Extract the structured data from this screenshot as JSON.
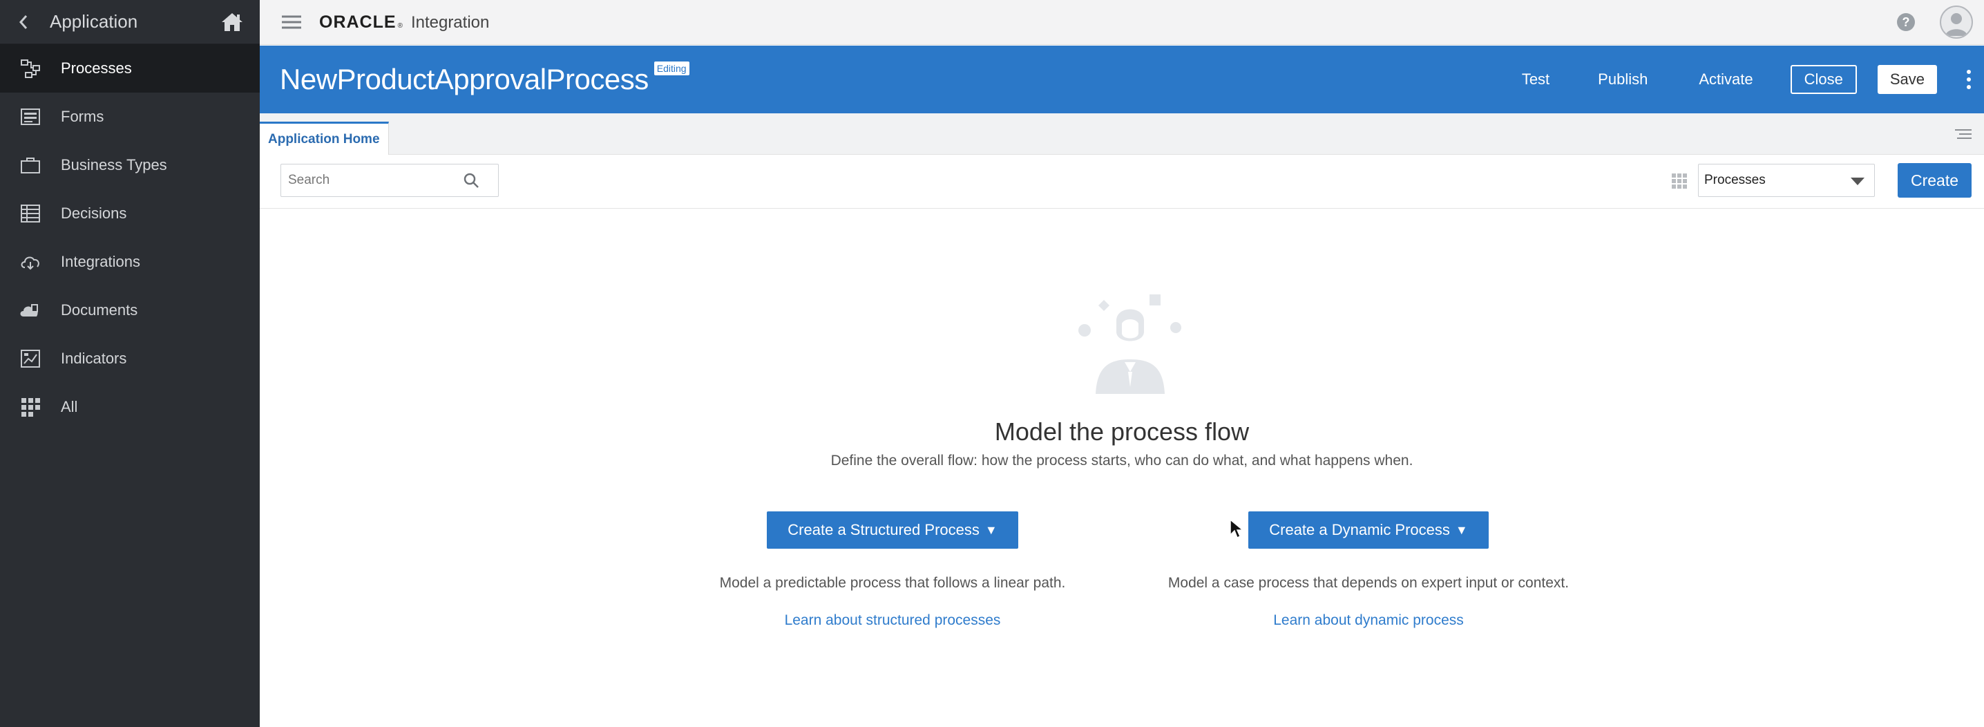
{
  "sidebar": {
    "title": "Application",
    "items": [
      {
        "label": "Processes",
        "icon": "process-icon",
        "active": true
      },
      {
        "label": "Forms",
        "icon": "forms-icon"
      },
      {
        "label": "Business Types",
        "icon": "briefcase-icon"
      },
      {
        "label": "Decisions",
        "icon": "table-icon"
      },
      {
        "label": "Integrations",
        "icon": "cloud-icon"
      },
      {
        "label": "Documents",
        "icon": "documents-icon"
      },
      {
        "label": "Indicators",
        "icon": "indicators-icon"
      },
      {
        "label": "All",
        "icon": "grid-icon"
      }
    ]
  },
  "topbar": {
    "brand": "ORACLE",
    "product": "Integration"
  },
  "appbar": {
    "title": "NewProductApprovalProcess",
    "badge": "Editing",
    "actions": {
      "test": "Test",
      "publish": "Publish",
      "activate": "Activate",
      "close": "Close",
      "save": "Save"
    }
  },
  "tabs": [
    {
      "label": "Application Home",
      "active": true
    }
  ],
  "toolbar": {
    "search_placeholder": "Search",
    "filter_value": "Processes",
    "create_label": "Create"
  },
  "empty_state": {
    "title": "Model the process flow",
    "subtitle": "Define the overall flow: how the process starts, who can do what, and what happens when.",
    "structured": {
      "button": "Create a Structured Process",
      "description": "Model a predictable process that follows a linear path.",
      "link": "Learn about structured processes"
    },
    "dynamic": {
      "button": "Create a Dynamic Process",
      "description": "Model a case process that depends on expert input or context.",
      "link": "Learn about dynamic process"
    }
  },
  "colors": {
    "sidebar_bg": "#2b2e33",
    "brand_blue": "#2b78c8",
    "link_blue": "#2f7ccc"
  }
}
